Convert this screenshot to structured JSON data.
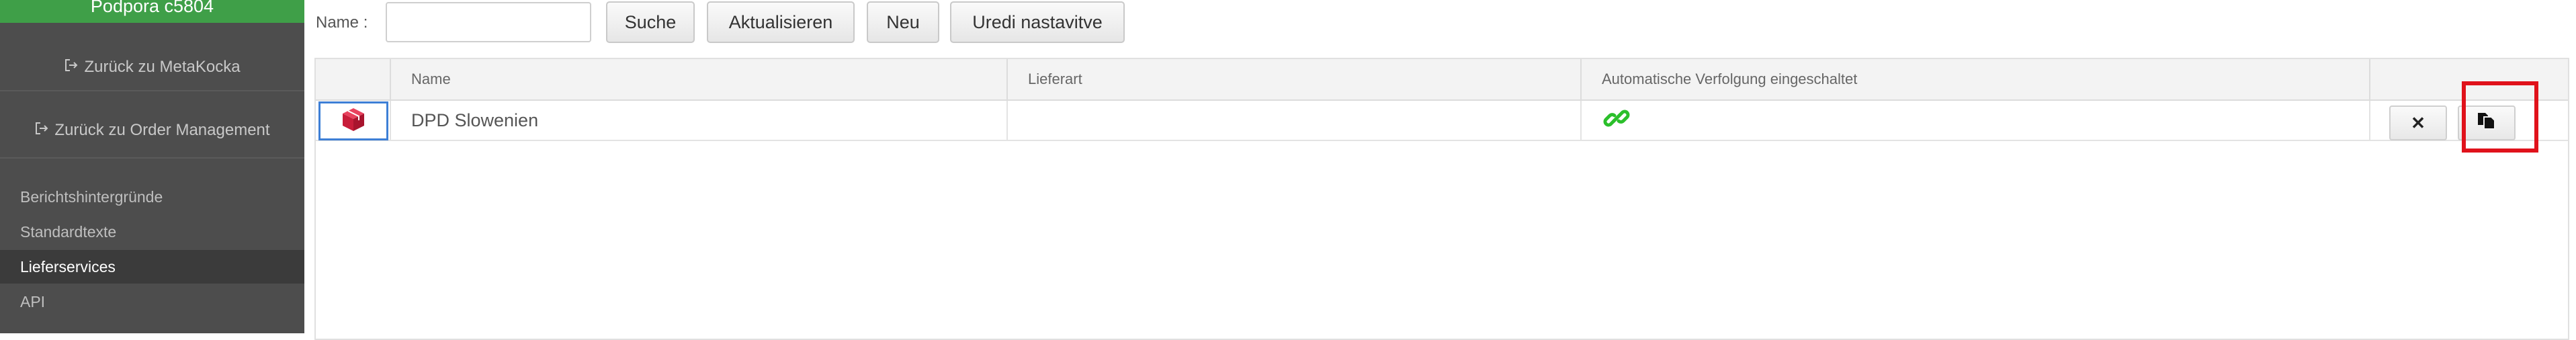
{
  "sidebar": {
    "brand": "Podpora c5804",
    "back_links": [
      {
        "label": "Zurück zu MetaKocka",
        "icon": "sign-out-icon"
      },
      {
        "label": "Zurück zu Order Management",
        "icon": "sign-out-icon"
      }
    ],
    "items": [
      {
        "label": "Berichtshintergründe",
        "active": false
      },
      {
        "label": "Standardtexte",
        "active": false
      },
      {
        "label": "Lieferservices",
        "active": true
      },
      {
        "label": "API",
        "active": false
      }
    ]
  },
  "toolbar": {
    "name_label": "Name :",
    "name_value": "",
    "search_label": "Suche",
    "refresh_label": "Aktualisieren",
    "new_label": "Neu",
    "edit_settings_label": "Uredi nastavitve"
  },
  "table": {
    "columns": [
      "",
      "Name",
      "Lieferart",
      "Automatische Verfolgung eingeschaltet",
      ""
    ],
    "rows": [
      {
        "icon": "package-icon",
        "name": "DPD Slowenien",
        "delivery_type": "",
        "tracking_icon": "link-icon",
        "actions": [
          {
            "name": "delete",
            "icon": "close-icon"
          },
          {
            "name": "copy",
            "icon": "copy-icon",
            "highlighted": true
          }
        ]
      }
    ]
  },
  "colors": {
    "sidebar_bg": "#4d4d4d",
    "brand_bg": "#3f9f48",
    "active_item_bg": "#3b3b3b",
    "highlight": "#e0121b",
    "link_icon": "#2bbf2b",
    "package_icon": "#d3213f"
  }
}
